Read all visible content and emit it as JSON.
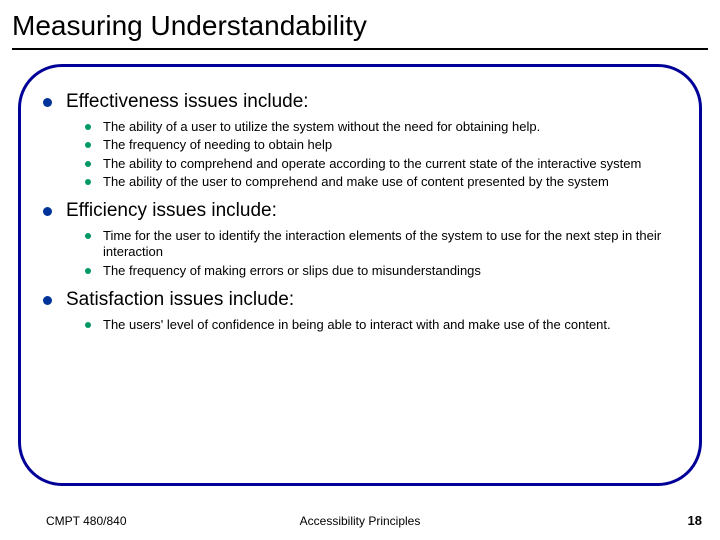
{
  "title": "Measuring Understandability",
  "sections": [
    {
      "heading": "Effectiveness issues include:",
      "items": [
        "The ability of a user to utilize the system without the need for obtaining help.",
        "The frequency of needing to obtain help",
        "The ability to comprehend and operate according to the current state of the interactive system",
        "The ability of the user to comprehend and make use of content presented by the system"
      ]
    },
    {
      "heading": "Efficiency issues include:",
      "items": [
        "Time for the user to identify the interaction elements of the system to use for the next step in their interaction",
        "The frequency of making errors or slips due to misunderstandings"
      ]
    },
    {
      "heading": "Satisfaction issues include:",
      "items": [
        "The users' level of confidence in being able to interact with and make use of the content."
      ]
    }
  ],
  "footer": {
    "left": "CMPT 480/840",
    "center": "Accessibility Principles",
    "page": "18"
  }
}
